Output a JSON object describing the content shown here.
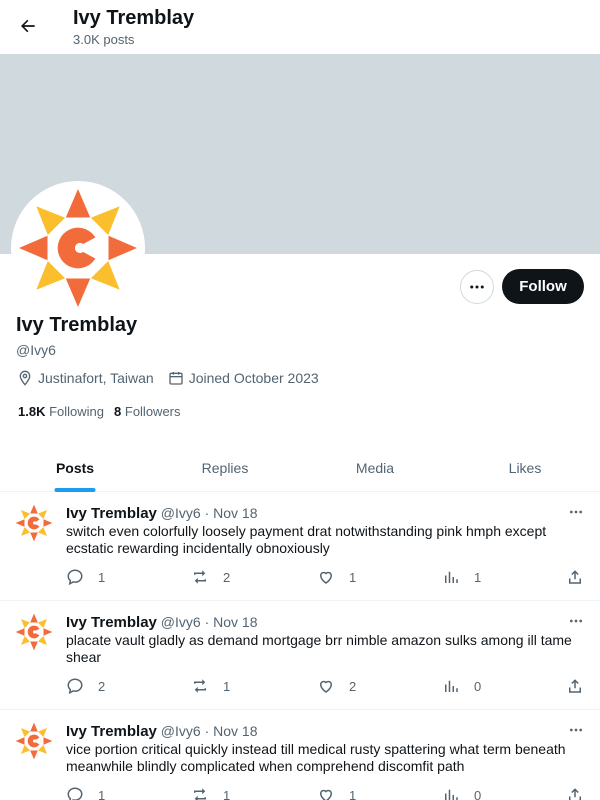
{
  "header": {
    "title": "Ivy Tremblay",
    "post_count": "3.0K posts",
    "back_icon": "arrow-left-icon"
  },
  "profile": {
    "name": "Ivy Tremblay",
    "handle": "@Ivy6",
    "location": "Justinafort, Taiwan",
    "joined": "Joined October 2023",
    "following_count": "1.8K",
    "following_label": "Following",
    "followers_count": "8",
    "followers_label": "Followers",
    "follow_label": "Follow",
    "banner_color": "#cfd9de"
  },
  "tabs": [
    {
      "label": "Posts",
      "active": true
    },
    {
      "label": "Replies",
      "active": false
    },
    {
      "label": "Media",
      "active": false
    },
    {
      "label": "Likes",
      "active": false
    }
  ],
  "posts": [
    {
      "name": "Ivy Tremblay",
      "handle": "@Ivy6",
      "sep": "·",
      "date": "Nov 18",
      "text": "switch even colorfully loosely payment drat notwithstanding pink hmph except ecstatic rewarding incidentally obnoxiously",
      "replies": "1",
      "reposts": "2",
      "likes": "1",
      "views": "1"
    },
    {
      "name": "Ivy Tremblay",
      "handle": "@Ivy6",
      "sep": "·",
      "date": "Nov 18",
      "text": "placate vault gladly as demand mortgage brr nimble amazon sulks among ill tame shear",
      "replies": "2",
      "reposts": "1",
      "likes": "2",
      "views": "0"
    },
    {
      "name": "Ivy Tremblay",
      "handle": "@Ivy6",
      "sep": "·",
      "date": "Nov 18",
      "text": "vice portion critical quickly instead till medical rusty spattering what term beneath meanwhile blindly complicated when comprehend discomfit path",
      "replies": "1",
      "reposts": "1",
      "likes": "1",
      "views": "0"
    }
  ],
  "colors": {
    "accent": "#1d9bf0",
    "logo_orange": "#f26b3a",
    "logo_yellow": "#fbbf2d",
    "text_secondary": "#536471"
  }
}
